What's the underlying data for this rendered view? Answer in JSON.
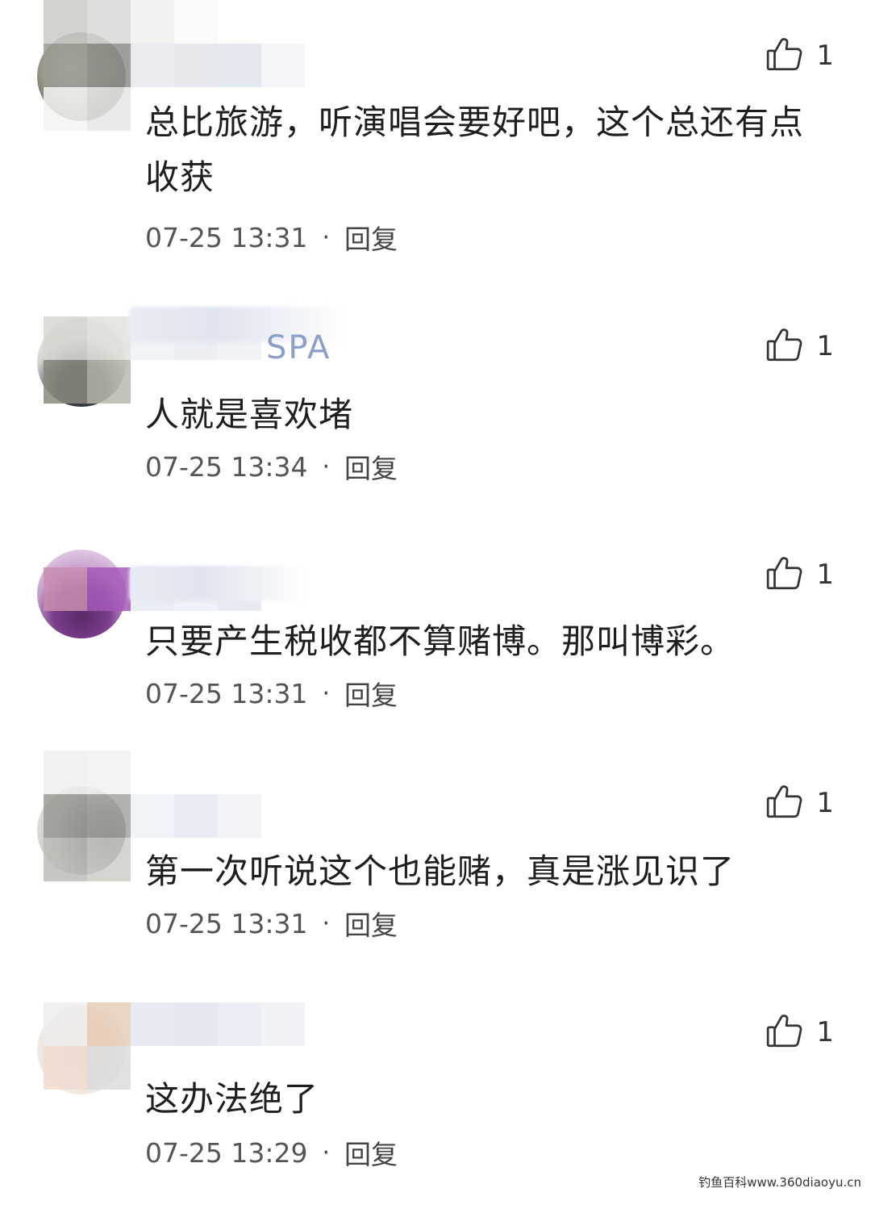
{
  "comments": [
    {
      "text": "总比旅游，听演唱会要好吧，这个总还有点收获",
      "time": "07-25 13:31",
      "separator": "·",
      "reply_label": "回复",
      "likes": "1"
    },
    {
      "name_fragment": "SPA",
      "text": "人就是喜欢堵",
      "time": "07-25 13:34",
      "separator": "·",
      "reply_label": "回复",
      "likes": "1"
    },
    {
      "text": "只要产生税收都不算赌博。那叫博彩。",
      "time": "07-25 13:31",
      "separator": "·",
      "reply_label": "回复",
      "likes": "1"
    },
    {
      "text": "第一次听说这个也能赌，真是涨见识了",
      "time": "07-25 13:31",
      "separator": "·",
      "reply_label": "回复",
      "likes": "1"
    },
    {
      "text": "这办法绝了",
      "time": "07-25 13:29",
      "separator": "·",
      "reply_label": "回复",
      "likes": "1"
    }
  ],
  "watermark": "钓鱼百科www.360diaoyu.cn",
  "icons": {
    "like": "thumbs-up-icon"
  },
  "colors": {
    "text": "#1e1e1e",
    "meta": "#555555",
    "background": "#ffffff"
  }
}
